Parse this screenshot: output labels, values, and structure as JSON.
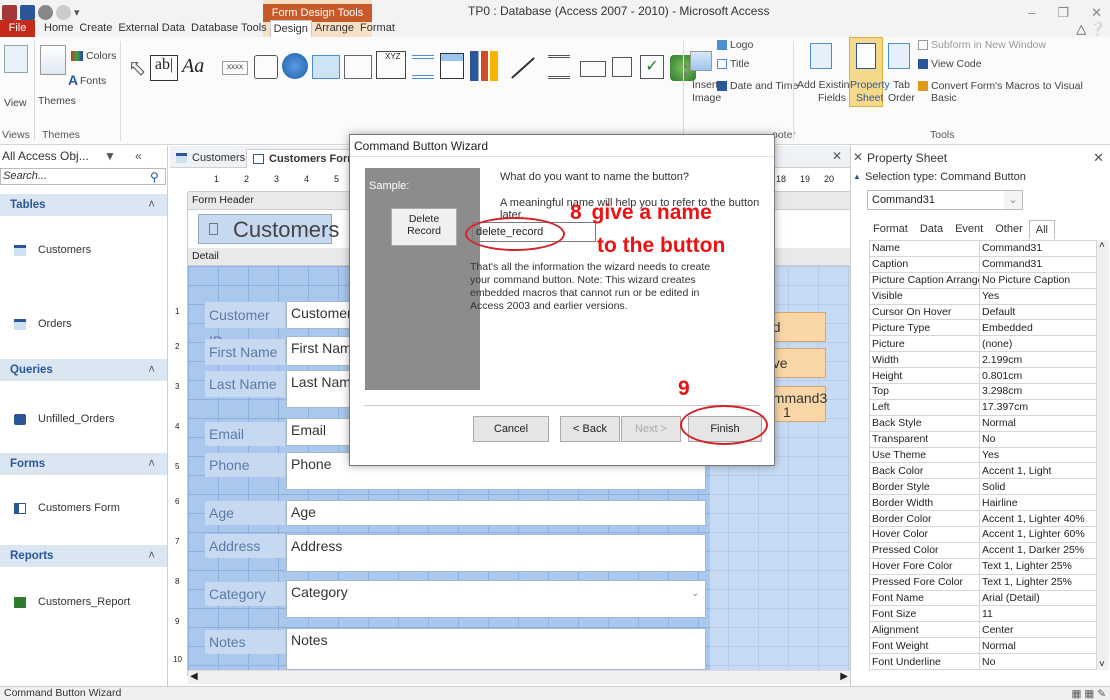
{
  "app": {
    "contextual_tab": "Form Design Tools",
    "window_title": "TP0 : Database (Access 2007 - 2010) - Microsoft Access",
    "tabs": [
      "File",
      "Home",
      "Create",
      "External Data",
      "Database Tools",
      "Design",
      "Arrange",
      "Format"
    ],
    "active_tab": "Design"
  },
  "ribbon": {
    "views": "View",
    "themes": "Themes",
    "colors": "Colors",
    "fonts": "Fonts",
    "group_views": "Views",
    "group_themes": "Themes",
    "group_tools": "Tools",
    "group_footer": "ooter",
    "ab": "ab|",
    "aa": "Aa",
    "xxxx": "XXXX",
    "xyz": "XYZ",
    "insert_image": "Insert\nImage",
    "insert": "Insert",
    "image": "Image",
    "logo": "Logo",
    "title": "Title",
    "date_time": "Date and Time",
    "add_fields_1": "Add Existing",
    "add_fields_2": "Fields",
    "prop_sheet_1": "Property",
    "prop_sheet_2": "Sheet",
    "tab_order_1": "Tab",
    "tab_order_2": "Order",
    "subform": "Subform in New Window",
    "view_code": "View Code",
    "convert": "Convert Form's Macros to Visual Basic"
  },
  "nav": {
    "header": "All Access Obj...",
    "search_placeholder": "Search...",
    "sections": [
      {
        "title": "Tables",
        "items": [
          "Customers",
          "Orders"
        ]
      },
      {
        "title": "Queries",
        "items": [
          "Unfilled_Orders"
        ]
      },
      {
        "title": "Forms",
        "items": [
          "Customers Form"
        ]
      },
      {
        "title": "Reports",
        "items": [
          "Customers_Report"
        ]
      }
    ]
  },
  "doc": {
    "tabs": [
      "Customers",
      "Customers Form"
    ],
    "ruler": [
      "1",
      "2",
      "3",
      "4",
      "5",
      "18",
      "19",
      "20"
    ],
    "form_header": "Form Header",
    "header_title": "Customers",
    "detail": "Detail",
    "vruler": [
      "1",
      "2",
      "3",
      "4",
      "5",
      "6",
      "7",
      "8",
      "9",
      "10"
    ],
    "fields": [
      {
        "label": "Customer ID",
        "value": "Customer I"
      },
      {
        "label": "First Name",
        "value": "First Name"
      },
      {
        "label": "Last Name",
        "value": "Last Name"
      },
      {
        "label": "Email",
        "value": "Email"
      },
      {
        "label": "Phone",
        "value": "Phone"
      },
      {
        "label": "Age",
        "value": "Age"
      },
      {
        "label": "Address",
        "value": "Address"
      },
      {
        "label": "Category",
        "value": "Category"
      },
      {
        "label": "Notes",
        "value": "Notes"
      }
    ],
    "btn_add": "dd Record",
    "btn_save": "ave Record",
    "btn_cmd": "ommand3\n1",
    "btn_cmd_1": "ommand3",
    "btn_cmd_2": "1"
  },
  "property_sheet": {
    "title": "Property Sheet",
    "selection_type": "Selection type: Command Button",
    "selected": "Command31",
    "tabs": [
      "Format",
      "Data",
      "Event",
      "Other",
      "All"
    ],
    "active_tab": "All",
    "rows": [
      [
        "Name",
        "Command31"
      ],
      [
        "Caption",
        "Command31"
      ],
      [
        "Picture Caption Arrangement",
        "No Picture Caption"
      ],
      [
        "Visible",
        "Yes"
      ],
      [
        "Cursor On Hover",
        "Default"
      ],
      [
        "Picture Type",
        "Embedded"
      ],
      [
        "Picture",
        "(none)"
      ],
      [
        "Width",
        "2.199cm"
      ],
      [
        "Height",
        "0.801cm"
      ],
      [
        "Top",
        "3.298cm"
      ],
      [
        "Left",
        "17.397cm"
      ],
      [
        "Back Style",
        "Normal"
      ],
      [
        "Transparent",
        "No"
      ],
      [
        "Use Theme",
        "Yes"
      ],
      [
        "Back Color",
        "Accent 1, Light"
      ],
      [
        "Border Style",
        "Solid"
      ],
      [
        "Border Width",
        "Hairline"
      ],
      [
        "Border Color",
        "Accent 1, Lighter 40%"
      ],
      [
        "Hover Color",
        "Accent 1, Lighter 60%"
      ],
      [
        "Pressed Color",
        "Accent 1, Darker 25%"
      ],
      [
        "Hover Fore Color",
        "Text 1, Lighter 25%"
      ],
      [
        "Pressed Fore Color",
        "Text 1, Lighter 25%"
      ],
      [
        "Font Name",
        "Arial (Detail)"
      ],
      [
        "Font Size",
        "11"
      ],
      [
        "Alignment",
        "Center"
      ],
      [
        "Font Weight",
        "Normal"
      ],
      [
        "Font Underline",
        "No"
      ]
    ]
  },
  "wizard": {
    "title": "Command Button Wizard",
    "sample_label": "Sample:",
    "sample_button": "Delete\nRecord",
    "sample_button_1": "Delete",
    "sample_button_2": "Record",
    "question": "What do you want to name the button?",
    "meaningful": "A meaningful name will help you to refer to the button later.",
    "name_value": "delete_record",
    "note": "That's all the information the wizard needs to create your command button. Note: This wizard creates embedded macros that cannot run or be edited in Access 2003 and earlier versions.",
    "cancel": "Cancel",
    "back": "< Back",
    "next": "Next >",
    "finish": "Finish"
  },
  "annotations": {
    "step8_number": "8",
    "step8_text_1": "give a name",
    "step8_text_2": "to the button",
    "step9": "9"
  },
  "status": "Command Button Wizard"
}
